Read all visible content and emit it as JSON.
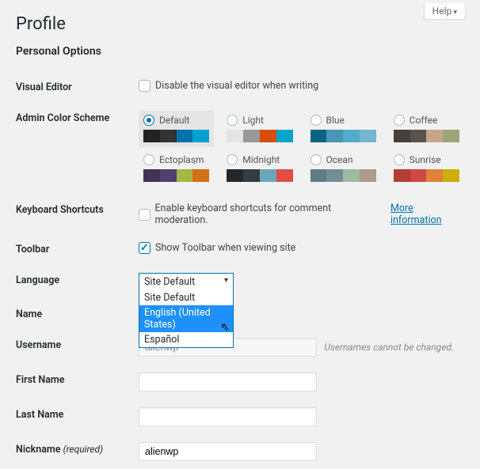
{
  "help": {
    "label": "Help"
  },
  "page_title": "Profile",
  "section_personal": "Personal Options",
  "section_name": "Name",
  "rows": {
    "visual_editor": {
      "th": "Visual Editor",
      "label": "Disable the visual editor when writing"
    },
    "color_scheme": {
      "th": "Admin Color Scheme"
    },
    "keyboard": {
      "th": "Keyboard Shortcuts",
      "label": "Enable keyboard shortcuts for comment moderation.",
      "more": "More information"
    },
    "toolbar": {
      "th": "Toolbar",
      "label": "Show Toolbar when viewing site"
    },
    "language": {
      "th": "Language",
      "selected": "Site Default",
      "options": [
        "Site Default",
        "English (United States)",
        "Español"
      ]
    },
    "username": {
      "th": "Username",
      "value": "alienwp",
      "note": "Usernames cannot be changed."
    },
    "first_name": {
      "th": "First Name",
      "value": ""
    },
    "last_name": {
      "th": "Last Name",
      "value": ""
    },
    "nickname": {
      "th": "Nickname",
      "req": "(required)",
      "value": "alienwp"
    }
  },
  "schemes": [
    {
      "name": "Default",
      "colors": [
        "#222222",
        "#333333",
        "#0073aa",
        "#00a0d2"
      ]
    },
    {
      "name": "Light",
      "colors": [
        "#e5e5e5",
        "#999999",
        "#d64e07",
        "#04a4cc"
      ]
    },
    {
      "name": "Blue",
      "colors": [
        "#096484",
        "#4796b3",
        "#52accc",
        "#74b6ce"
      ]
    },
    {
      "name": "Coffee",
      "colors": [
        "#46403c",
        "#59524c",
        "#c7a589",
        "#9ea476"
      ]
    },
    {
      "name": "Ectoplasm",
      "colors": [
        "#413256",
        "#523f6d",
        "#a3b745",
        "#d46f15"
      ]
    },
    {
      "name": "Midnight",
      "colors": [
        "#25282b",
        "#363b3f",
        "#69a8bb",
        "#e14d43"
      ]
    },
    {
      "name": "Ocean",
      "colors": [
        "#627c83",
        "#738e96",
        "#9ebaa0",
        "#aa9d88"
      ]
    },
    {
      "name": "Sunrise",
      "colors": [
        "#b43c38",
        "#cf4944",
        "#dd823b",
        "#ccaf0b"
      ]
    }
  ]
}
